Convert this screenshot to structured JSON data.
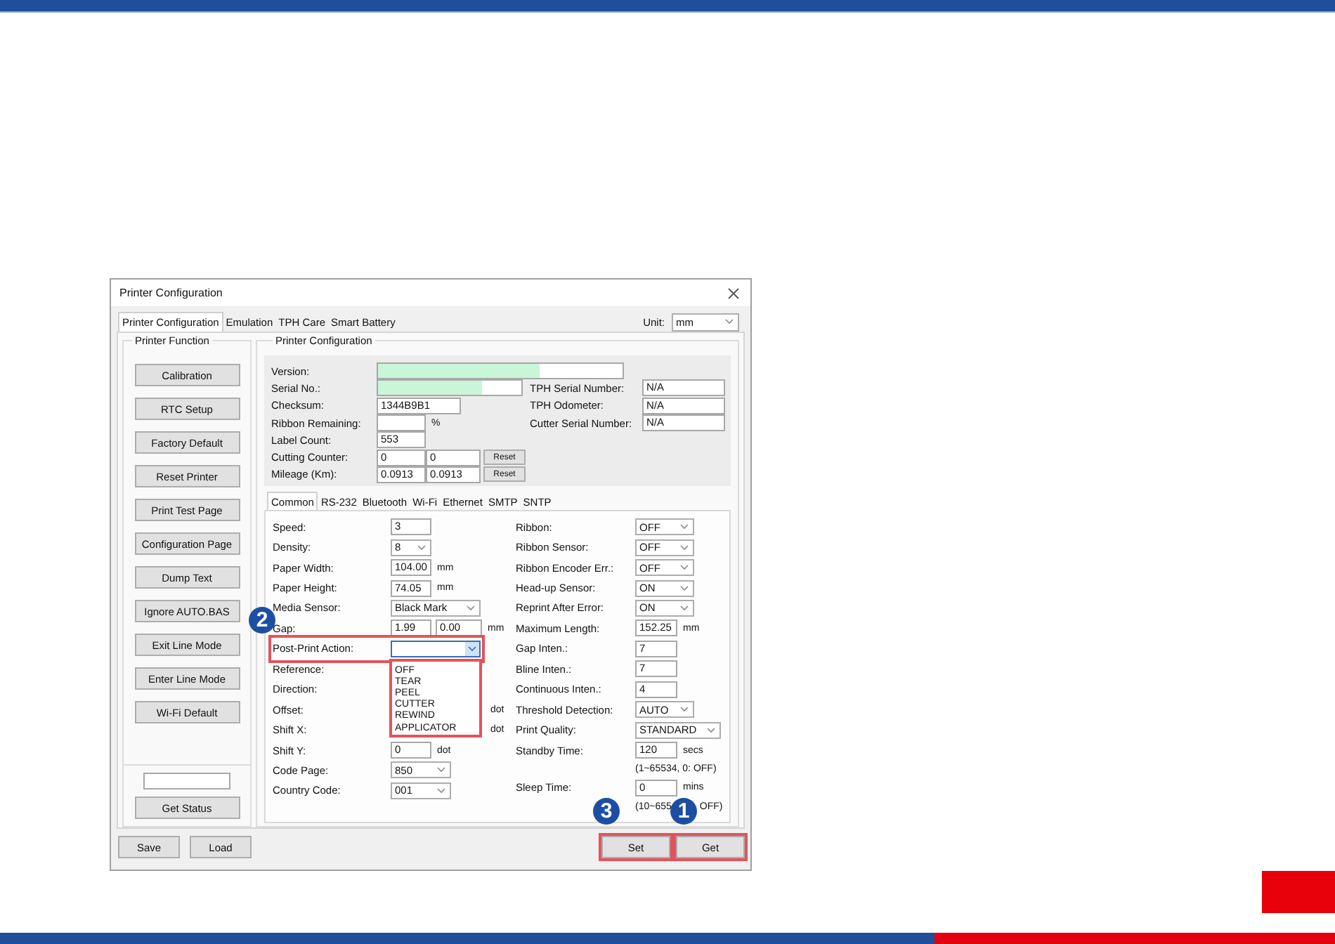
{
  "window": {
    "title": "Printer Configuration"
  },
  "tabs": [
    {
      "label": "Printer Configuration",
      "selected": true
    },
    {
      "label": "Emulation",
      "selected": false
    },
    {
      "label": "TPH Care",
      "selected": false
    },
    {
      "label": "Smart Battery",
      "selected": false
    }
  ],
  "unit": {
    "label": "Unit:",
    "value": "mm"
  },
  "printer_function": {
    "title": "Printer Function",
    "buttons": [
      "Calibration",
      "RTC Setup",
      "Factory Default",
      "Reset Printer",
      "Print Test Page",
      "Configuration Page",
      "Dump Text",
      "Ignore AUTO.BAS",
      "Exit Line Mode",
      "Enter Line Mode",
      "Wi-Fi Default"
    ],
    "status_button": "Get Status"
  },
  "printer_configuration": {
    "title": "Printer Configuration",
    "info_rows": [
      {
        "kind": "longbar",
        "label": "Version:",
        "level": 0.66
      },
      {
        "kind": "bar",
        "label": "Serial No.:",
        "level": 0.73,
        "side_label": "TPH Serial Number:",
        "side_value": "N/A"
      },
      {
        "kind": "code",
        "label": "Checksum:",
        "value": "1344B9B1",
        "side_label": "TPH Odometer:",
        "side_value": "N/A"
      },
      {
        "kind": "count",
        "label": "Ribbon Remaining:",
        "unit": "%",
        "side_label": "Cutter Serial Number:",
        "side_value": "N/A"
      },
      {
        "kind": "count",
        "label": "Label Count:",
        "value": "553"
      },
      {
        "kind": "counter",
        "label": "Cutting Counter:",
        "values": [
          "0",
          "0"
        ],
        "button": "Reset"
      },
      {
        "kind": "counter",
        "label": "Mileage (Km):",
        "values": [
          "0.0913",
          "0.0913"
        ],
        "button": "Reset"
      }
    ],
    "subtabs": [
      {
        "label": "Common",
        "selected": true
      },
      {
        "label": "RS-232",
        "selected": false
      },
      {
        "label": "Bluetooth",
        "selected": false
      },
      {
        "label": "Wi-Fi",
        "selected": false
      },
      {
        "label": "Ethernet",
        "selected": false
      },
      {
        "label": "SMTP",
        "selected": false
      },
      {
        "label": "SNTP",
        "selected": false
      }
    ],
    "left_settings": [
      {
        "label": "Speed:",
        "kind": "text",
        "value": "3"
      },
      {
        "label": "Density:",
        "kind": "narrowselect",
        "value": "8"
      },
      {
        "label": "Paper Width:",
        "kind": "text",
        "value": "104.00",
        "unit": "mm"
      },
      {
        "label": "Paper Height:",
        "kind": "text",
        "value": "74.05",
        "unit": "mm"
      },
      {
        "label": "Media Sensor:",
        "kind": "wideselect",
        "value": "Black Mark"
      },
      {
        "label": "Gap:",
        "kind": "double",
        "values": [
          "1.99",
          "0.00"
        ],
        "unit": "mm"
      },
      {
        "label": "Post-Print Action:",
        "kind": "open",
        "options": [
          "OFF",
          "TEAR",
          "PEEL",
          "CUTTER",
          "REWIND",
          "APPLICATOR"
        ],
        "highlighted": true
      },
      {
        "label": "Reference:",
        "kind": "covered"
      },
      {
        "label": "Direction:",
        "kind": "covered"
      },
      {
        "label": "Offset:",
        "kind": "covered",
        "unit": "dot"
      },
      {
        "label": "Shift X:",
        "kind": "covered",
        "unit": "dot"
      },
      {
        "label": "Shift Y:",
        "kind": "text",
        "value": "0",
        "unit": "dot"
      },
      {
        "label": "Code Page:",
        "kind": "select",
        "value": "850"
      },
      {
        "label": "Country Code:",
        "kind": "select",
        "value": "001"
      }
    ],
    "right_settings": [
      {
        "label": "Ribbon:",
        "kind": "select",
        "value": "OFF"
      },
      {
        "label": "Ribbon Sensor:",
        "kind": "select",
        "value": "OFF"
      },
      {
        "label": "Ribbon Encoder Err.:",
        "kind": "select",
        "value": "OFF"
      },
      {
        "label": "Head-up Sensor:",
        "kind": "select",
        "value": "ON"
      },
      {
        "label": "Reprint After Error:",
        "kind": "select",
        "value": "ON"
      },
      {
        "label": "Maximum Length:",
        "kind": "text",
        "value": "152.25",
        "unit": "mm"
      },
      {
        "label": "Gap Inten.:",
        "kind": "text",
        "value": "7"
      },
      {
        "label": "Bline Inten.:",
        "kind": "text",
        "value": "7"
      },
      {
        "label": "Continuous Inten.:",
        "kind": "text",
        "value": "4"
      },
      {
        "label": "Threshold Detection:",
        "kind": "select",
        "value": "AUTO"
      },
      {
        "label": "Print Quality:",
        "kind": "wideselect",
        "value": "STANDARD"
      },
      {
        "label": "Standby Time:",
        "kind": "text",
        "value": "120",
        "unit": "secs"
      },
      {
        "kind": "hint",
        "texts": [
          "(1~65534, 0: OFF)"
        ]
      },
      {
        "label": "Sleep Time:",
        "kind": "text",
        "value": "0",
        "unit": "mins"
      },
      {
        "kind": "hint",
        "texts": [
          "(10~655",
          "OFF)"
        ]
      }
    ]
  },
  "footer_left_buttons": [
    {
      "label": "Save",
      "highlighted": false
    },
    {
      "label": "Load",
      "highlighted": false
    }
  ],
  "footer_right_buttons": [
    {
      "label": "Set",
      "highlighted": true
    },
    {
      "label": "Get",
      "highlighted": true
    }
  ],
  "callouts": [
    {
      "label": "2"
    },
    {
      "label": "3"
    },
    {
      "label": "1"
    }
  ]
}
